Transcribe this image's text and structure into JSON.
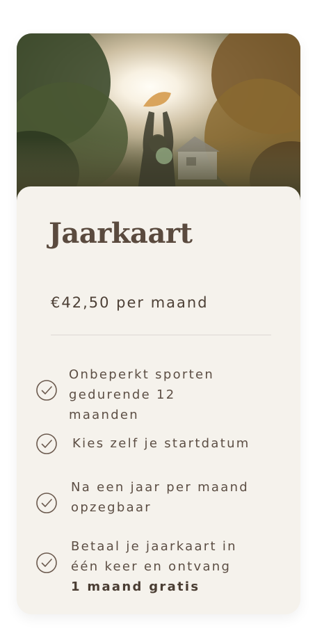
{
  "plan": {
    "title": "Jaarkaart",
    "price": "€42,50 per maand"
  },
  "features": [
    {
      "lines": [
        "Onbeperkt sporten",
        "gedurende 12",
        "maanden"
      ],
      "icon": "check-circle-icon"
    },
    {
      "lines": [
        "Kies zelf je startdatum"
      ],
      "icon": "check-circle-icon"
    },
    {
      "lines": [
        "Na een jaar per maand",
        "opzegbaar"
      ],
      "icon": "check-circle-icon"
    },
    {
      "lines": [
        "Betaal je jaarkaart in",
        "één keer en ontvang"
      ],
      "bold_line": "1 maand gratis",
      "icon": "check-circle-icon"
    }
  ],
  "colors": {
    "card_background": "#f5f2ec",
    "title": "#5a4a3e",
    "text": "#5c4e44",
    "icon_stroke": "#6b5a4e",
    "divider": "#dcd8d3"
  }
}
